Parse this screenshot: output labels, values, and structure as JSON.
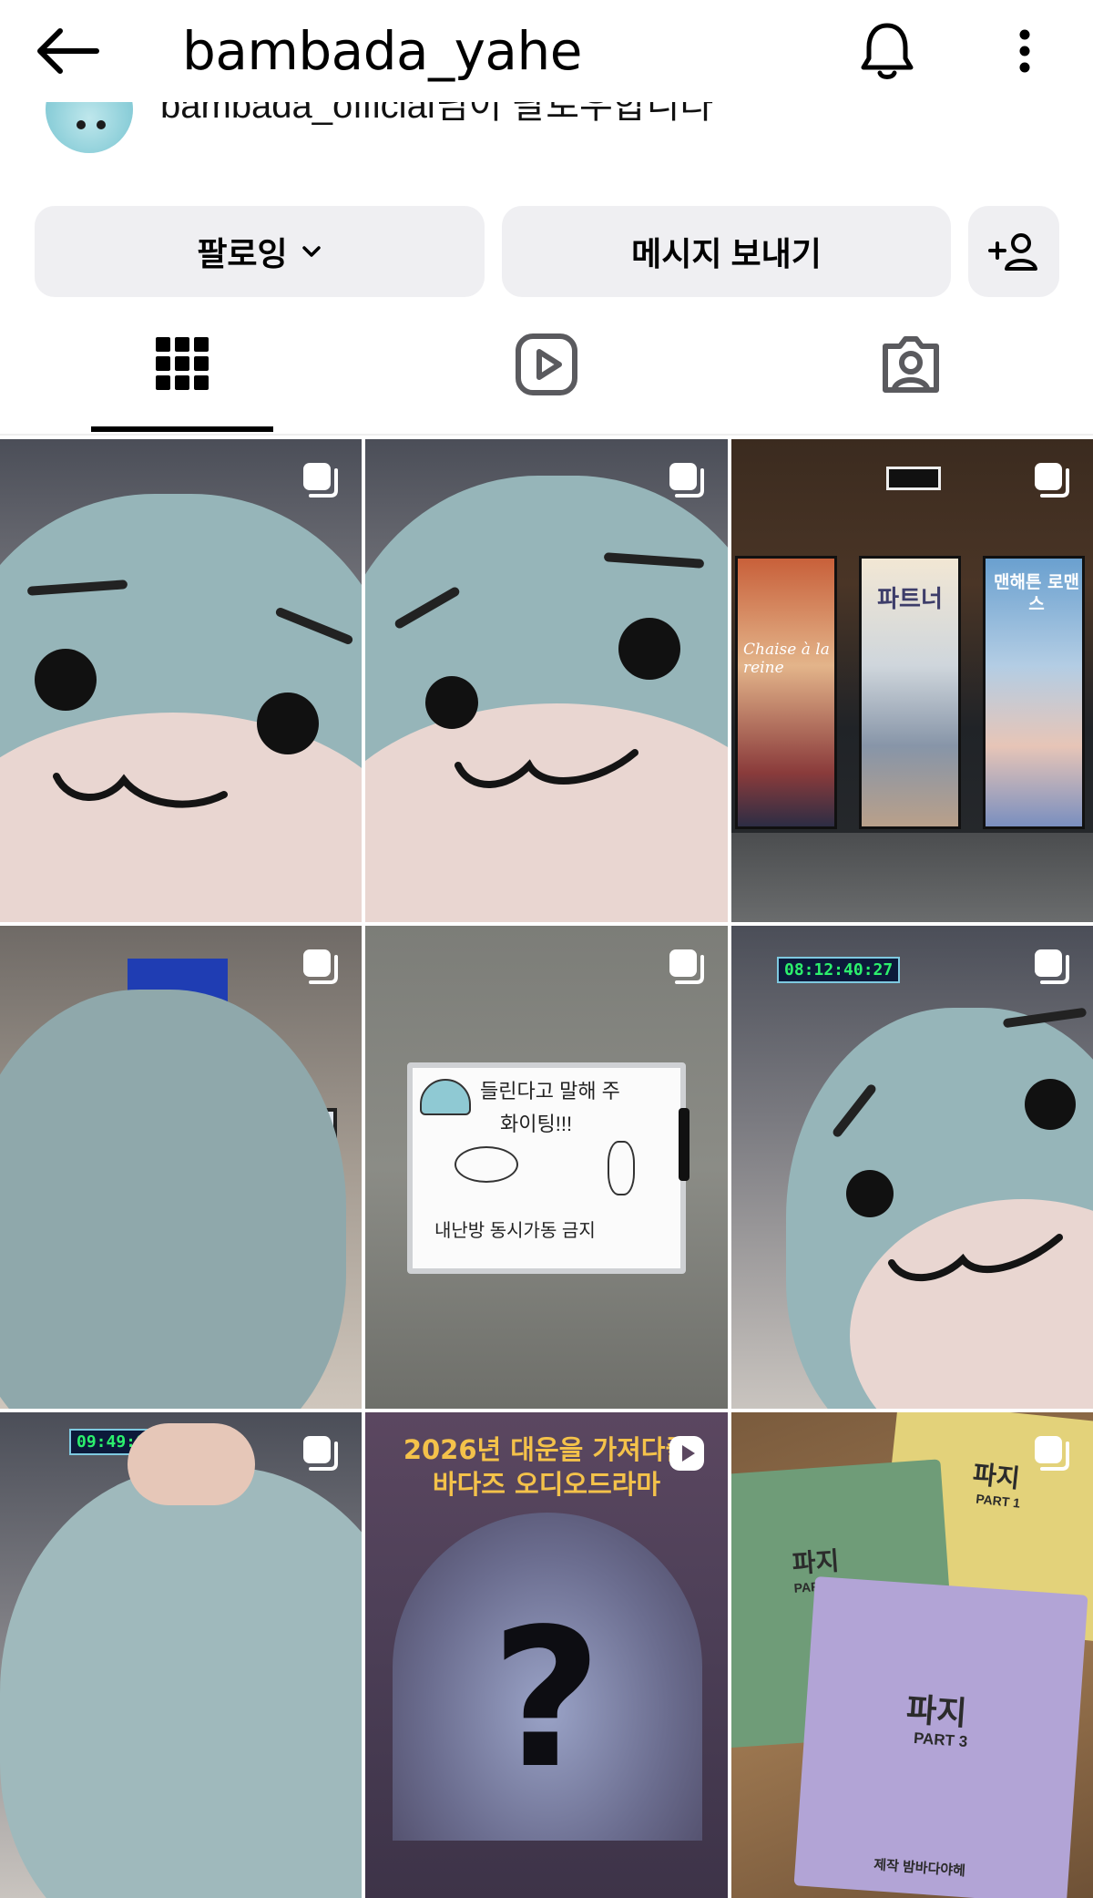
{
  "header": {
    "username": "bambada_yahe",
    "back_icon": "arrow-left-icon",
    "bell_icon": "bell-icon",
    "more_icon": "more-vertical-icon"
  },
  "followed_by": {
    "text": "bambada_official님이 팔로우합니다"
  },
  "actions": {
    "following_label": "팔로잉",
    "message_label": "메시지 보내기",
    "add_person_icon": "add-person-icon"
  },
  "tabs": [
    {
      "name": "grid",
      "icon": "grid-icon",
      "active": true
    },
    {
      "name": "reels",
      "icon": "reels-icon",
      "active": false
    },
    {
      "name": "tagged",
      "icon": "tagged-icon",
      "active": false
    }
  ],
  "grid": {
    "posts": [
      {
        "type": "carousel",
        "subject": "plush"
      },
      {
        "type": "carousel",
        "subject": "plush"
      },
      {
        "type": "carousel",
        "subject": "posters"
      },
      {
        "type": "carousel",
        "subject": "plush"
      },
      {
        "type": "carousel",
        "subject": "whiteboard"
      },
      {
        "type": "carousel",
        "subject": "plush"
      },
      {
        "type": "carousel",
        "subject": "plush"
      },
      {
        "type": "reel",
        "subject": "audio-drama-poster"
      },
      {
        "type": "carousel",
        "subject": "scripts"
      }
    ],
    "poster_titles": [
      "파트너",
      "맨해튼 로맨스"
    ],
    "poster_cursive": "Chaise à la reine",
    "timer_1": "08:12:40:27",
    "timer_2": "09:49:09",
    "drama_title_line1": "2026년 대운을 가져다줄",
    "drama_title_line2": "바다즈 오디오드라마",
    "drama_mark": "?",
    "whiteboard_line1": "들린다고 말해 주",
    "whiteboard_line2": "화이팅!!!",
    "whiteboard_line3": "내난방 동시가동 금지",
    "script_title": "파지",
    "script_part1": "PART 1",
    "script_part2": "PART 2",
    "script_part3": "PART 3",
    "script_footer": "제작 밤바다야헤"
  },
  "colors": {
    "button_bg": "#efeff2",
    "plush_blue": "#96b5b9",
    "plush_belly": "#e9d6d1",
    "drama_gold": "#f4c24a"
  }
}
